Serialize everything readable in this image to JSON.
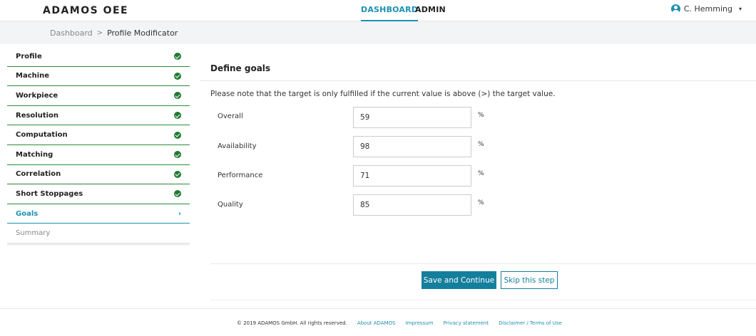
{
  "header": {
    "logo": "ADAMOS OEE",
    "nav": [
      "DASHBOARD",
      "ADMIN"
    ],
    "user_name": "C. Hemming",
    "user_caret": "▾"
  },
  "breadcrumb": {
    "items": [
      "Dashboard",
      "Profile Modificator"
    ],
    "separator": ">"
  },
  "sidebar": {
    "steps": [
      {
        "label": "Profile",
        "status": "complete"
      },
      {
        "label": "Machine",
        "status": "complete"
      },
      {
        "label": "Workpiece",
        "status": "complete"
      },
      {
        "label": "Resolution",
        "status": "complete"
      },
      {
        "label": "Computation",
        "status": "complete"
      },
      {
        "label": "Matching",
        "status": "complete"
      },
      {
        "label": "Correlation",
        "status": "complete"
      },
      {
        "label": "Short Stoppages",
        "status": "complete"
      },
      {
        "label": "Goals",
        "status": "active",
        "indicator": "›"
      },
      {
        "label": "Summary",
        "status": "pending"
      }
    ]
  },
  "main": {
    "title": "Define goals",
    "note": "Please note that the target is only fulfilled if the current value is above (>) the target value.",
    "goals": [
      {
        "label": "Overall",
        "value": "59",
        "unit": "%"
      },
      {
        "label": "Availability",
        "value": "98",
        "unit": "%"
      },
      {
        "label": "Performance",
        "value": "71",
        "unit": "%"
      },
      {
        "label": "Quality",
        "value": "85",
        "unit": "%"
      }
    ],
    "save_label": "Save and Continue",
    "skip_label": "Skip this step"
  },
  "footer": {
    "copyright": "© 2019 ADAMOS GmbH. All rights reserved.",
    "links": [
      "About ADAMOS",
      "Impressum",
      "Privacy statement",
      "Disclaimer / Terms of Use"
    ]
  },
  "colors": {
    "accent": "#1e90b0",
    "primary_button": "#147f9c",
    "complete": "#1f7a30"
  }
}
